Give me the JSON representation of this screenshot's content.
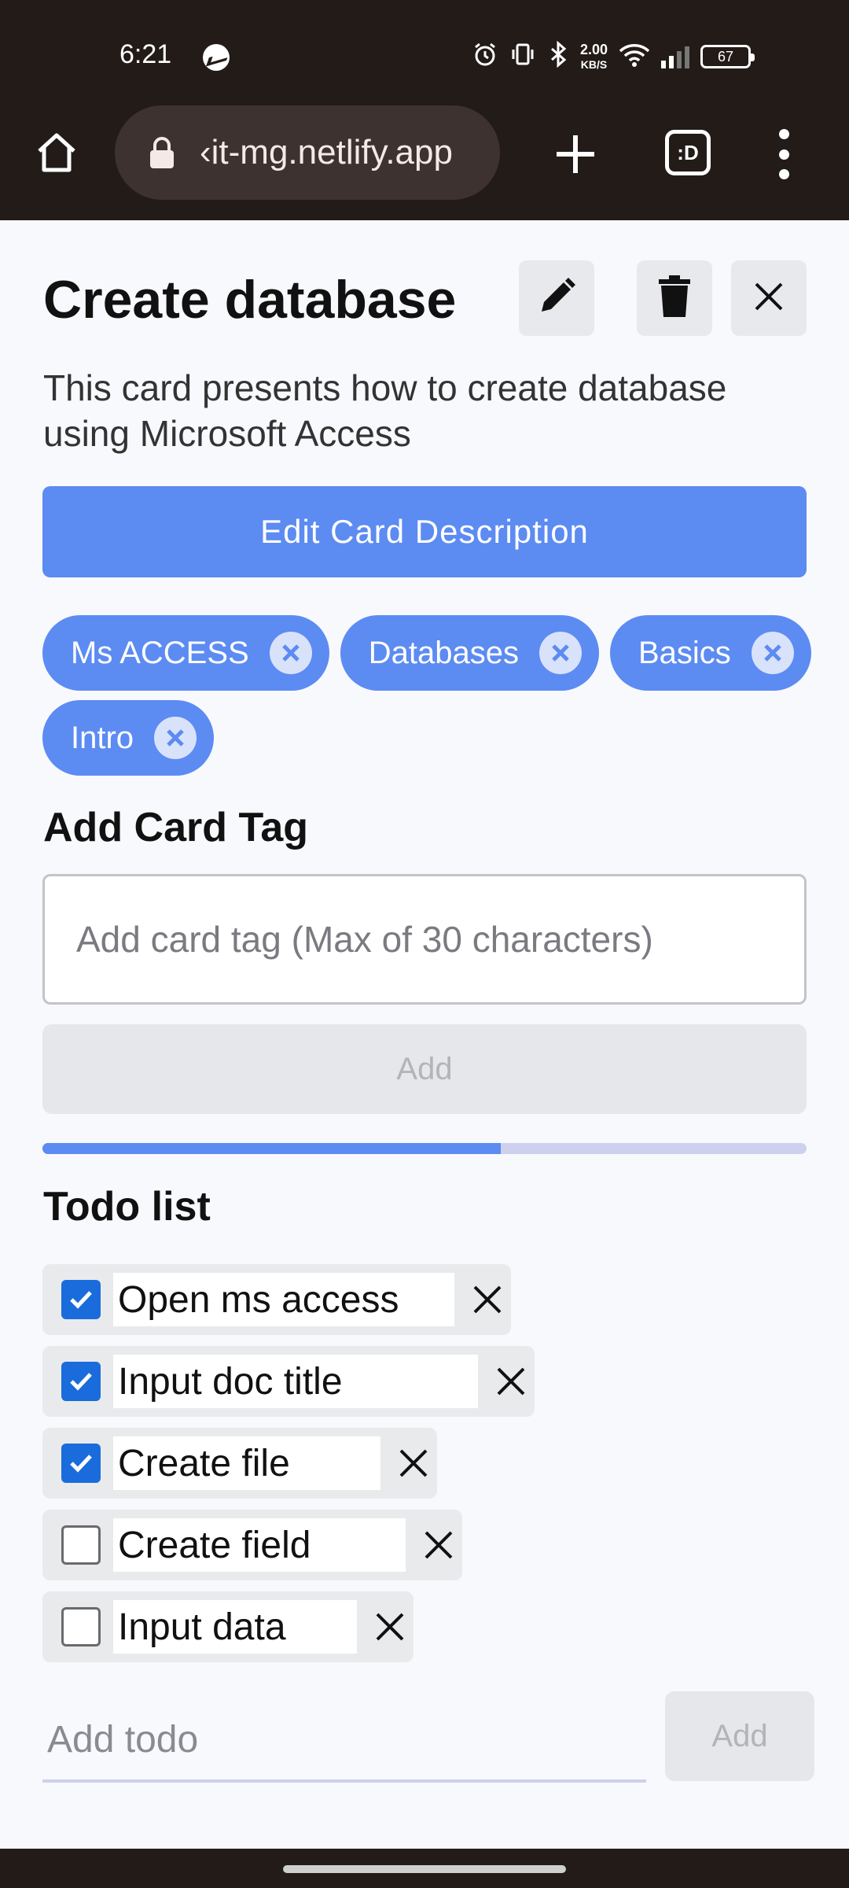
{
  "status_bar": {
    "time": "6:21",
    "network_speed": "2.00",
    "network_unit": "KB/S",
    "battery": "67"
  },
  "browser": {
    "url": "‹it-mg.netlify.app",
    "tabs_label": ":D"
  },
  "card": {
    "title": "Create database",
    "description": "This card presents how to create database using Microsoft Access",
    "edit_description_label": "Edit Card Description",
    "tags": [
      "Ms ACCESS",
      "Databases",
      "Basics",
      "Intro"
    ]
  },
  "add_tag": {
    "heading": "Add Card Tag",
    "placeholder": "Add card tag (Max of 30 characters)",
    "button_label": "Add"
  },
  "progress": {
    "value": 0.6
  },
  "todo": {
    "heading": "Todo list",
    "items": [
      {
        "text": "Open ms access",
        "done": true
      },
      {
        "text": "Input doc title",
        "done": true
      },
      {
        "text": "Create file",
        "done": true
      },
      {
        "text": "Create field",
        "done": false
      },
      {
        "text": "Input data",
        "done": false
      }
    ],
    "add_placeholder": "Add todo",
    "add_button_label": "Add"
  },
  "colors": {
    "accent": "#5c8bf2",
    "checkbox_checked": "#1a6cdc",
    "chrome_background": "#221b18"
  }
}
